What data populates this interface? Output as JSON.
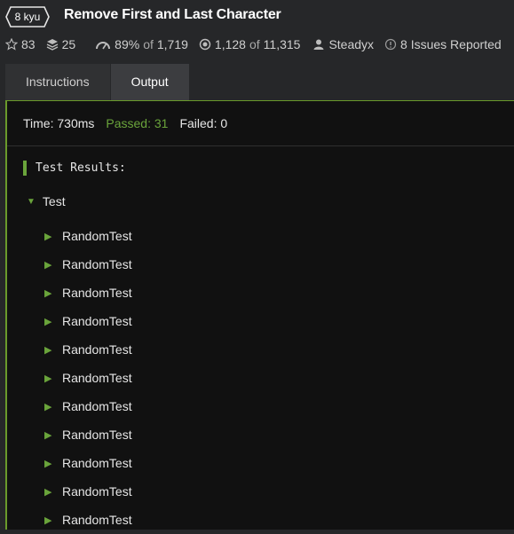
{
  "kata": {
    "rank": "8 kyu",
    "title": "Remove First and Last Character"
  },
  "stats": {
    "stars": "83",
    "collections": "25",
    "satisfaction": "89%",
    "votes_of": "of",
    "votes": "1,719",
    "completed": "1,128",
    "attempts_of": "of",
    "attempts": "11,315",
    "author": "Steadyx",
    "issues": "8 Issues Reported"
  },
  "tabs": [
    {
      "label": "Instructions"
    },
    {
      "label": "Output"
    }
  ],
  "summary": {
    "time": "Time: 730ms",
    "passed": "Passed: 31",
    "failed": "Failed: 0"
  },
  "results": {
    "header": "Test Results:",
    "group": "Test",
    "tests": [
      "RandomTest",
      "RandomTest",
      "RandomTest",
      "RandomTest",
      "RandomTest",
      "RandomTest",
      "RandomTest",
      "RandomTest",
      "RandomTest",
      "RandomTest",
      "RandomTest"
    ]
  },
  "colors": {
    "accent": "#6aa43b",
    "background": "#262729",
    "panel": "#111111"
  }
}
